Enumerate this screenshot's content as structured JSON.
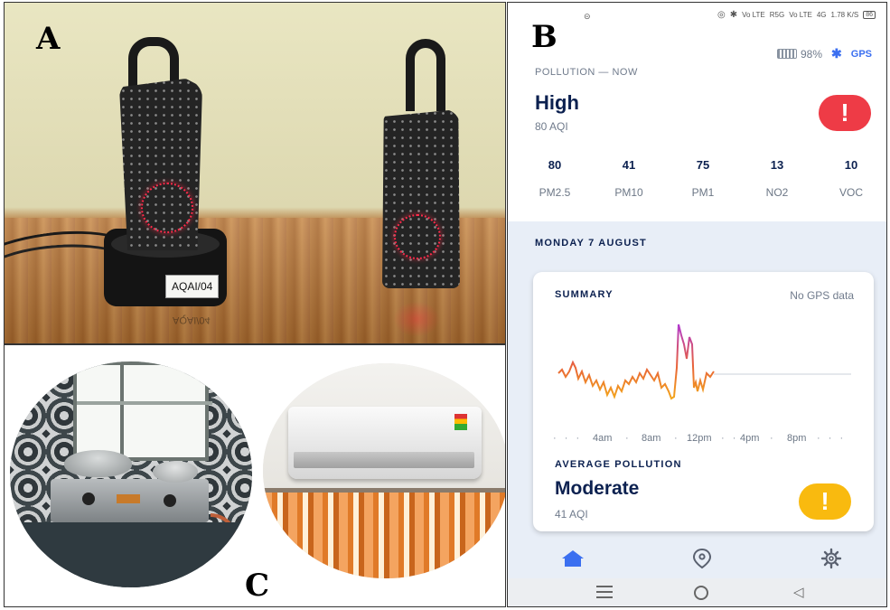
{
  "panels": {
    "a": "A",
    "b": "B",
    "c": "C"
  },
  "photo": {
    "sticker": "AQAI/04",
    "sticker_reflection": "AQAI/04"
  },
  "phone": {
    "status": {
      "network1": "Vo LTE",
      "signal1": "R5G",
      "network2": "Vo LTE",
      "signal2": "4G",
      "speed": "1.78 K/S",
      "battery": "86"
    },
    "device_battery": "98%",
    "gps_label": "GPS",
    "section_now": "POLLUTION — NOW",
    "level": "High",
    "aqi": "80 AQI",
    "alert_glyph": "!",
    "stats": [
      {
        "value": "80",
        "label": "PM2.5"
      },
      {
        "value": "41",
        "label": "PM10"
      },
      {
        "value": "75",
        "label": "PM1"
      },
      {
        "value": "13",
        "label": "NO2"
      },
      {
        "value": "10",
        "label": "VOC"
      }
    ],
    "date": "MONDAY 7 AUGUST",
    "summary_title": "SUMMARY",
    "gps_status": "No GPS data",
    "time_ticks": [
      "4am",
      "8am",
      "12pm",
      "4pm",
      "8pm"
    ],
    "average_title": "AVERAGE POLLUTION",
    "average_level": "Moderate",
    "average_aqi": "41 AQI",
    "average_glyph": "!",
    "colors": {
      "high": "#ee3b46",
      "moderate": "#f9ba0f",
      "navy": "#0c2150",
      "accent": "#3b6ff0",
      "light_bg": "#e8eef7"
    },
    "icons": [
      "home-icon",
      "location-pin-icon",
      "settings-gear-icon",
      "bluetooth-icon",
      "battery-icon"
    ]
  }
}
